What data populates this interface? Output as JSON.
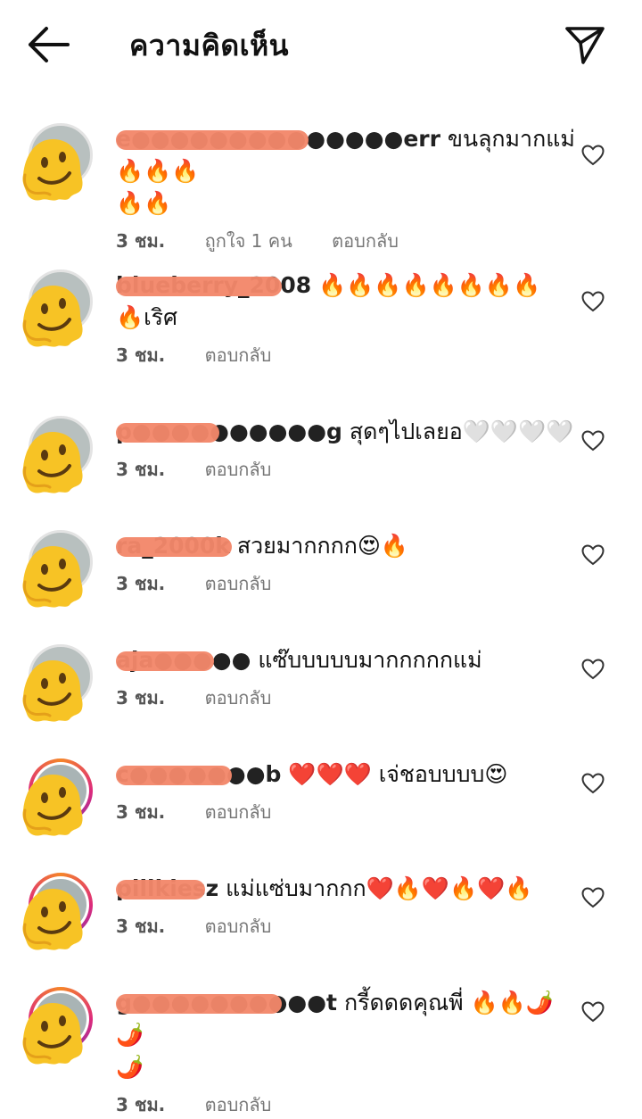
{
  "header": {
    "title": "ความคิดเห็น",
    "back_icon": "arrow-left-icon",
    "send_icon": "send-paper-plane-icon"
  },
  "colors": {
    "redaction": "#f2876a",
    "story_ring_start": "#f58529",
    "story_ring_end": "#dd2a7b"
  },
  "comments": [
    {
      "username": "e●●●●●●●●●●●●●●err",
      "text": "ขนลุกมากแม่ 🔥🔥🔥\n🔥🔥",
      "time": "3 ชม.",
      "likes": "ถูกใจ 1 คน",
      "reply": "ตอบกลับ",
      "ring": "plain"
    },
    {
      "username": "blueberry_2008",
      "text": "🔥🔥🔥🔥🔥🔥🔥🔥\n🔥เริศ",
      "time": "3 ชม.",
      "likes": "",
      "reply": "ตอบกลับ",
      "ring": "plain"
    },
    {
      "username": "p●●●●●●●●●●g",
      "text": "สุดๆไปเลยอ🤍🤍🤍🤍",
      "time": "3 ชม.",
      "likes": "",
      "reply": "ตอบกลับ",
      "ring": "plain"
    },
    {
      "username": "ra_2000k",
      "text": "สวยมากกกก😍🔥",
      "time": "3 ชม.",
      "likes": "",
      "reply": "ตอบกลับ",
      "ring": "plain"
    },
    {
      "username": "aja●●●●●",
      "text": "แซ๊บบบบบมากกกกกแม่",
      "time": "3 ชม.",
      "likes": "",
      "reply": "ตอบกลับ",
      "ring": "plain"
    },
    {
      "username": "c●●●●●●●b",
      "text": "❤️❤️❤️ เจ่ชอบบบบ😍",
      "time": "3 ชม.",
      "likes": "",
      "reply": "ตอบกลับ",
      "ring": "story"
    },
    {
      "username": "pillkiesz",
      "text": "แม่แซ่บมากกก❤️🔥❤️🔥❤️🔥",
      "time": "3 ชม.",
      "likes": "",
      "reply": "ตอบกลับ",
      "ring": "story"
    },
    {
      "username": "g●●●●●●●●●●t",
      "text": "กรี้ดดดคุณพี่ 🔥🔥🌶️🌶️\n🌶️",
      "time": "3 ชม.",
      "likes": "",
      "reply": "ตอบกลับ",
      "ring": "story"
    }
  ]
}
